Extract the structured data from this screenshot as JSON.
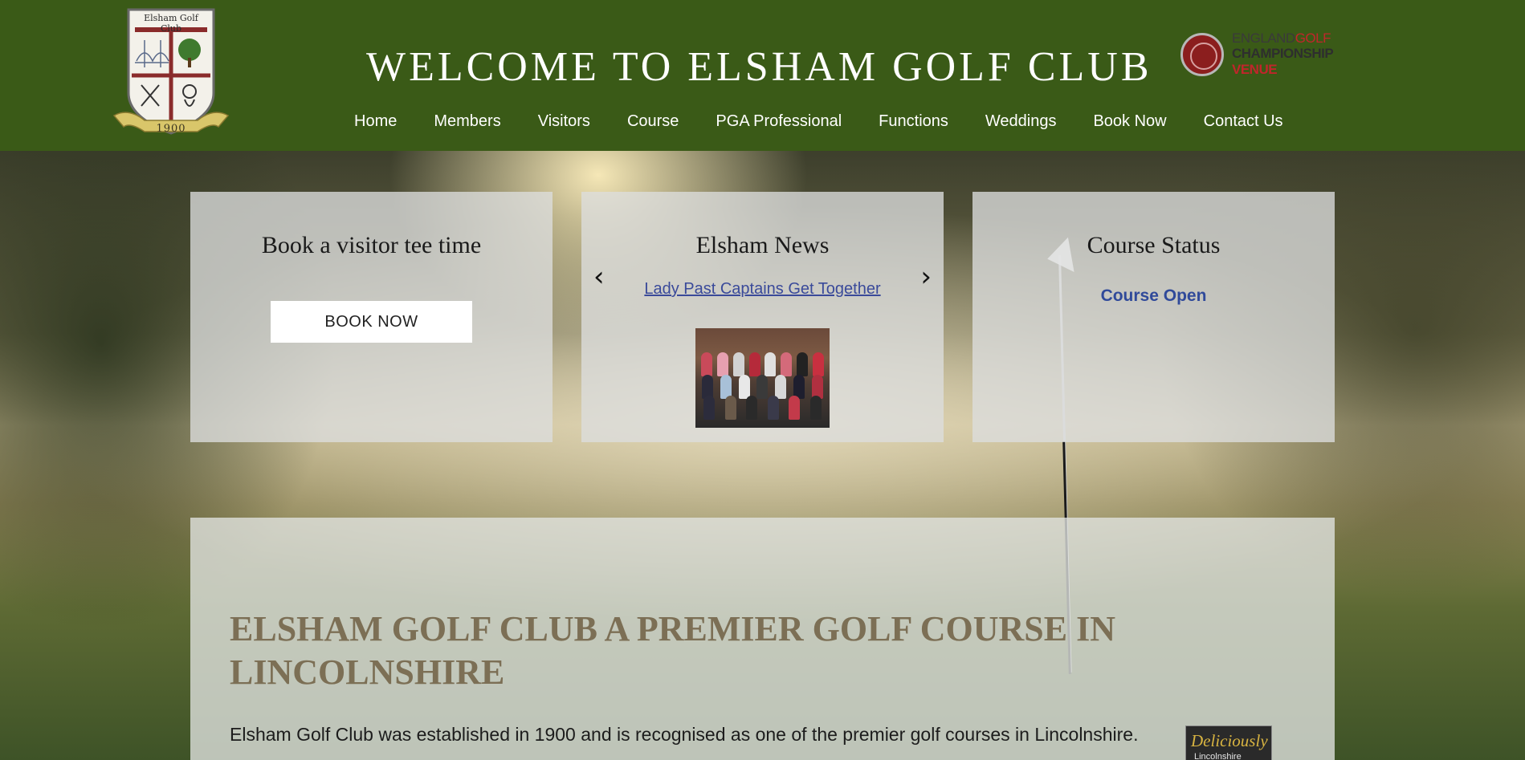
{
  "header": {
    "crest_name": "Elsham Golf Club",
    "crest_year": "1900",
    "title": "WELCOME TO ELSHAM GOLF CLUB",
    "badge": {
      "line1_a": "ENGLAND",
      "line1_b": "GOLF",
      "line2": "CHAMPIONSHIP",
      "line3": "VENUE"
    }
  },
  "nav": {
    "items": [
      {
        "label": "Home"
      },
      {
        "label": "Members"
      },
      {
        "label": "Visitors"
      },
      {
        "label": "Course"
      },
      {
        "label": "PGA Professional"
      },
      {
        "label": "Functions"
      },
      {
        "label": "Weddings"
      },
      {
        "label": "Book Now"
      },
      {
        "label": "Contact Us"
      }
    ]
  },
  "cards": {
    "tee_time": {
      "title": "Book a visitor tee time",
      "button": "BOOK NOW"
    },
    "news": {
      "title": "Elsham News",
      "link": "Lady Past Captains Get Together",
      "prev": "‹",
      "next": "›"
    },
    "status": {
      "title": "Course Status",
      "value": "Course Open"
    }
  },
  "main": {
    "heading": "ELSHAM GOLF CLUB A PREMIER GOLF COURSE IN LINCOLNSHIRE",
    "body": "Elsham Golf Club was established in 1900 and is recognised as one of the premier golf courses in Lincolnshire.",
    "logo_l1": "Deliciously",
    "logo_l2": "Lincolnshire"
  },
  "colors": {
    "header_bg": "#3a5a17",
    "heading": "#7c6f55",
    "link": "#3a4a9a",
    "status": "#304a9a"
  }
}
